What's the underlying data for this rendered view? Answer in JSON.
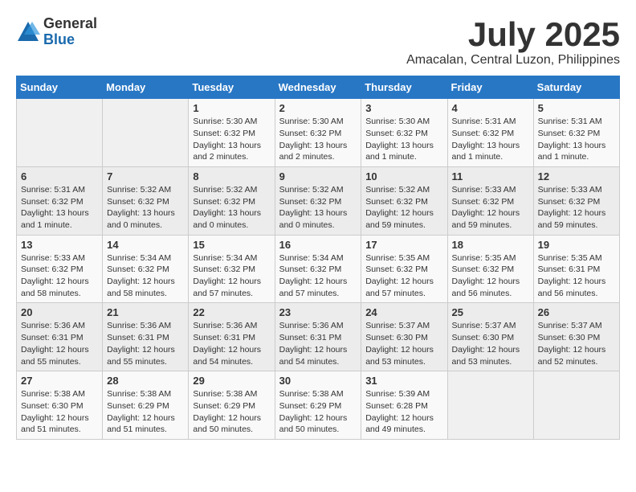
{
  "header": {
    "logo_general": "General",
    "logo_blue": "Blue",
    "month_title": "July 2025",
    "location": "Amacalan, Central Luzon, Philippines"
  },
  "weekdays": [
    "Sunday",
    "Monday",
    "Tuesday",
    "Wednesday",
    "Thursday",
    "Friday",
    "Saturday"
  ],
  "weeks": [
    [
      {
        "day": "",
        "info": ""
      },
      {
        "day": "",
        "info": ""
      },
      {
        "day": "1",
        "info": "Sunrise: 5:30 AM\nSunset: 6:32 PM\nDaylight: 13 hours and 2 minutes."
      },
      {
        "day": "2",
        "info": "Sunrise: 5:30 AM\nSunset: 6:32 PM\nDaylight: 13 hours and 2 minutes."
      },
      {
        "day": "3",
        "info": "Sunrise: 5:30 AM\nSunset: 6:32 PM\nDaylight: 13 hours and 1 minute."
      },
      {
        "day": "4",
        "info": "Sunrise: 5:31 AM\nSunset: 6:32 PM\nDaylight: 13 hours and 1 minute."
      },
      {
        "day": "5",
        "info": "Sunrise: 5:31 AM\nSunset: 6:32 PM\nDaylight: 13 hours and 1 minute."
      }
    ],
    [
      {
        "day": "6",
        "info": "Sunrise: 5:31 AM\nSunset: 6:32 PM\nDaylight: 13 hours and 1 minute."
      },
      {
        "day": "7",
        "info": "Sunrise: 5:32 AM\nSunset: 6:32 PM\nDaylight: 13 hours and 0 minutes."
      },
      {
        "day": "8",
        "info": "Sunrise: 5:32 AM\nSunset: 6:32 PM\nDaylight: 13 hours and 0 minutes."
      },
      {
        "day": "9",
        "info": "Sunrise: 5:32 AM\nSunset: 6:32 PM\nDaylight: 13 hours and 0 minutes."
      },
      {
        "day": "10",
        "info": "Sunrise: 5:32 AM\nSunset: 6:32 PM\nDaylight: 12 hours and 59 minutes."
      },
      {
        "day": "11",
        "info": "Sunrise: 5:33 AM\nSunset: 6:32 PM\nDaylight: 12 hours and 59 minutes."
      },
      {
        "day": "12",
        "info": "Sunrise: 5:33 AM\nSunset: 6:32 PM\nDaylight: 12 hours and 59 minutes."
      }
    ],
    [
      {
        "day": "13",
        "info": "Sunrise: 5:33 AM\nSunset: 6:32 PM\nDaylight: 12 hours and 58 minutes."
      },
      {
        "day": "14",
        "info": "Sunrise: 5:34 AM\nSunset: 6:32 PM\nDaylight: 12 hours and 58 minutes."
      },
      {
        "day": "15",
        "info": "Sunrise: 5:34 AM\nSunset: 6:32 PM\nDaylight: 12 hours and 57 minutes."
      },
      {
        "day": "16",
        "info": "Sunrise: 5:34 AM\nSunset: 6:32 PM\nDaylight: 12 hours and 57 minutes."
      },
      {
        "day": "17",
        "info": "Sunrise: 5:35 AM\nSunset: 6:32 PM\nDaylight: 12 hours and 57 minutes."
      },
      {
        "day": "18",
        "info": "Sunrise: 5:35 AM\nSunset: 6:32 PM\nDaylight: 12 hours and 56 minutes."
      },
      {
        "day": "19",
        "info": "Sunrise: 5:35 AM\nSunset: 6:31 PM\nDaylight: 12 hours and 56 minutes."
      }
    ],
    [
      {
        "day": "20",
        "info": "Sunrise: 5:36 AM\nSunset: 6:31 PM\nDaylight: 12 hours and 55 minutes."
      },
      {
        "day": "21",
        "info": "Sunrise: 5:36 AM\nSunset: 6:31 PM\nDaylight: 12 hours and 55 minutes."
      },
      {
        "day": "22",
        "info": "Sunrise: 5:36 AM\nSunset: 6:31 PM\nDaylight: 12 hours and 54 minutes."
      },
      {
        "day": "23",
        "info": "Sunrise: 5:36 AM\nSunset: 6:31 PM\nDaylight: 12 hours and 54 minutes."
      },
      {
        "day": "24",
        "info": "Sunrise: 5:37 AM\nSunset: 6:30 PM\nDaylight: 12 hours and 53 minutes."
      },
      {
        "day": "25",
        "info": "Sunrise: 5:37 AM\nSunset: 6:30 PM\nDaylight: 12 hours and 53 minutes."
      },
      {
        "day": "26",
        "info": "Sunrise: 5:37 AM\nSunset: 6:30 PM\nDaylight: 12 hours and 52 minutes."
      }
    ],
    [
      {
        "day": "27",
        "info": "Sunrise: 5:38 AM\nSunset: 6:30 PM\nDaylight: 12 hours and 51 minutes."
      },
      {
        "day": "28",
        "info": "Sunrise: 5:38 AM\nSunset: 6:29 PM\nDaylight: 12 hours and 51 minutes."
      },
      {
        "day": "29",
        "info": "Sunrise: 5:38 AM\nSunset: 6:29 PM\nDaylight: 12 hours and 50 minutes."
      },
      {
        "day": "30",
        "info": "Sunrise: 5:38 AM\nSunset: 6:29 PM\nDaylight: 12 hours and 50 minutes."
      },
      {
        "day": "31",
        "info": "Sunrise: 5:39 AM\nSunset: 6:28 PM\nDaylight: 12 hours and 49 minutes."
      },
      {
        "day": "",
        "info": ""
      },
      {
        "day": "",
        "info": ""
      }
    ]
  ]
}
